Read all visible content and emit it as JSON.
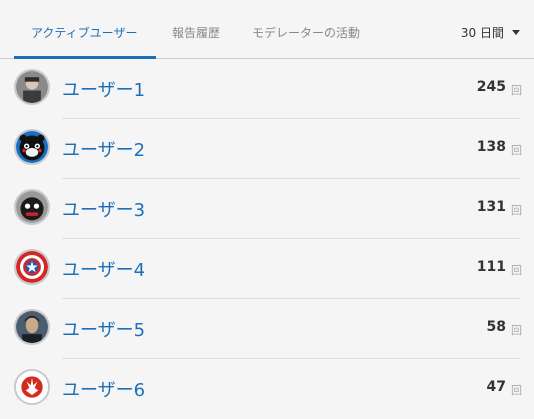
{
  "tabs": [
    {
      "label": "アクティブユーザー",
      "active": true
    },
    {
      "label": "報告履歴",
      "active": false
    },
    {
      "label": "モデレーターの活動",
      "active": false
    }
  ],
  "range": {
    "label": "30 日間"
  },
  "users": [
    {
      "name": "ユーザー1",
      "count": "245",
      "unit": "回",
      "avatar": "grey-portrait-icon"
    },
    {
      "name": "ユーザー2",
      "count": "138",
      "unit": "回",
      "avatar": "black-bear-mascot-icon"
    },
    {
      "name": "ユーザー3",
      "count": "131",
      "unit": "回",
      "avatar": "black-creature-icon"
    },
    {
      "name": "ユーザー4",
      "count": "111",
      "unit": "回",
      "avatar": "star-shield-icon"
    },
    {
      "name": "ユーザー5",
      "count": "58",
      "unit": "回",
      "avatar": "man-portrait-icon"
    },
    {
      "name": "ユーザー6",
      "count": "47",
      "unit": "回",
      "avatar": "rebel-emblem-icon"
    }
  ],
  "colors": {
    "accent": "#1d6fb8",
    "divider": "#e0e0e0",
    "shield_red": "#d0282a",
    "shield_blue": "#2a57a8",
    "rebel_red": "#d52b1e"
  }
}
